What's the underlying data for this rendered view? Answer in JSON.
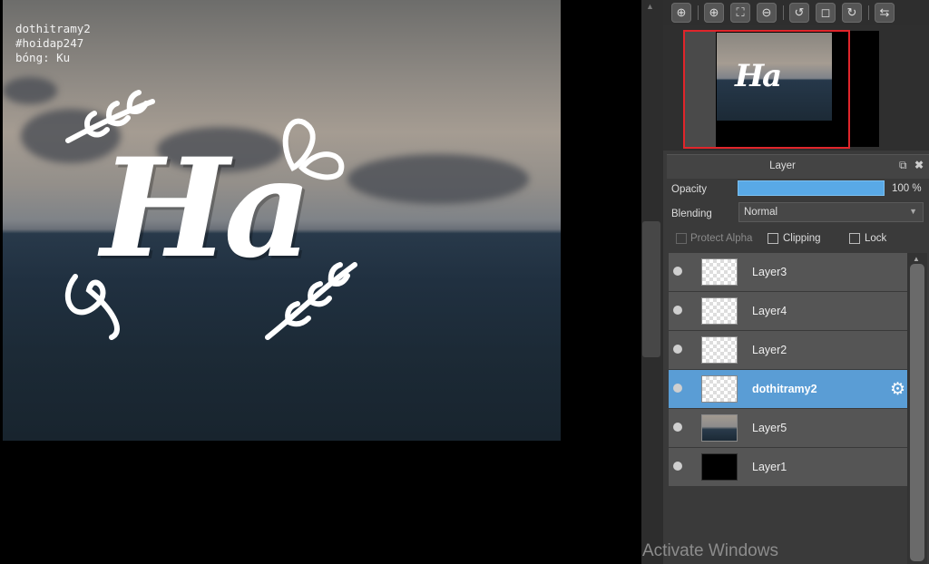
{
  "canvas": {
    "watermark": [
      "dothitramy2",
      "#hoidap247",
      "bóng: Ku"
    ],
    "artwork_text": "Ha"
  },
  "navigator": {
    "toolbar_icons": [
      "zoom-fit-icon",
      "zoom-in-icon",
      "fit-window-icon",
      "zoom-out-icon",
      "rotate-left-icon",
      "reset-view-icon",
      "rotate-right-icon",
      "flip-horizontal-icon"
    ],
    "preview_text": "Ha"
  },
  "layer_panel": {
    "title": "Layer",
    "opacity_label": "Opacity",
    "opacity_value": "100 %",
    "opacity_fraction": 1.0,
    "blending_label": "Blending",
    "blending_value": "Normal",
    "protect_alpha_label": "Protect Alpha",
    "clipping_label": "Clipping",
    "lock_label": "Lock",
    "layers": [
      {
        "name": "Layer3",
        "thumb": "transparent",
        "selected": false
      },
      {
        "name": "Layer4",
        "thumb": "transparent",
        "selected": false
      },
      {
        "name": "Layer2",
        "thumb": "transparent",
        "selected": false
      },
      {
        "name": "dothitramy2",
        "thumb": "transparent",
        "selected": true
      },
      {
        "name": "Layer5",
        "thumb": "photo",
        "selected": false
      },
      {
        "name": "Layer1",
        "thumb": "black",
        "selected": false
      }
    ]
  },
  "os_overlay": {
    "activate_windows": "Activate Windows"
  },
  "colors": {
    "selection": "#5a9dd5",
    "opacity_bar": "#59a9e6",
    "navigator_frame": "#e0252b"
  }
}
